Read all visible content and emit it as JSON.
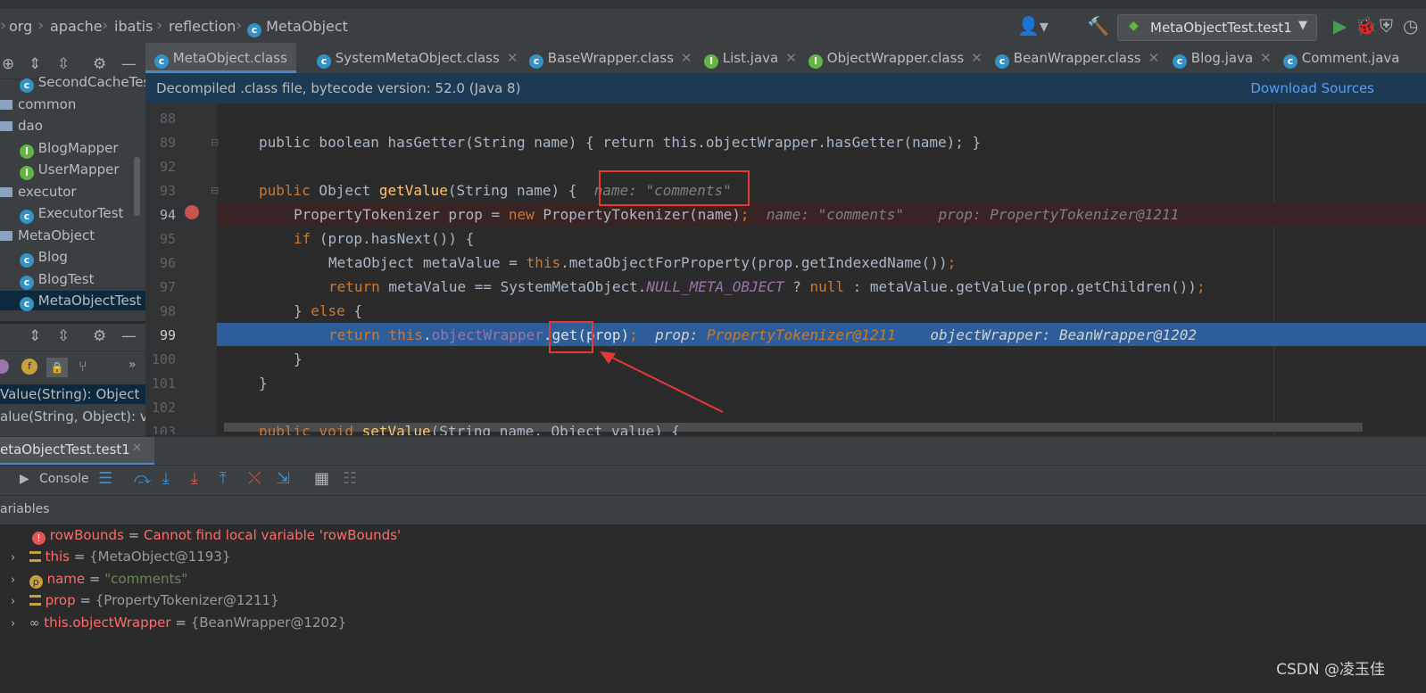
{
  "breadcrumb": [
    "org",
    "apache",
    "ibatis",
    "reflection",
    "MetaObject"
  ],
  "run_config": "MetaObjectTest.test1",
  "tabs": [
    {
      "label": "MetaObject.class",
      "active": true
    },
    {
      "label": "SystemMetaObject.class"
    },
    {
      "label": "BaseWrapper.class"
    },
    {
      "label": "List.java"
    },
    {
      "label": "ObjectWrapper.class"
    },
    {
      "label": "BeanWrapper.class"
    },
    {
      "label": "Blog.java"
    },
    {
      "label": "Comment.java"
    }
  ],
  "info_bar": {
    "text": "Decompiled .class file, bytecode version: 52.0 (Java 8)",
    "link": "Download Sources"
  },
  "project_tree": [
    "SecondCacheTes",
    "common",
    "dao",
    "BlogMapper",
    "UserMapper",
    "executor",
    "ExecutorTest",
    "MetaObject",
    "Blog",
    "BlogTest",
    "MetaObjectTest"
  ],
  "structure_items": [
    "Value(String): Object",
    "alue(String, Object): vo"
  ],
  "code": {
    "lines": [
      "88",
      "89",
      "92",
      "93",
      "94",
      "95",
      "96",
      "97",
      "98",
      "99",
      "100",
      "101",
      "102",
      "103"
    ],
    "l89": "public boolean hasGetter(String name) { return this.objectWrapper.hasGetter(name); }",
    "l93_hint": "name: \"comments\"",
    "l94_hint_a": "name: \"comments\"",
    "l94_hint_b": "prop: PropertyTokenizer@1211",
    "l99_hint_a_name": "prop:",
    "l99_hint_a_val": "PropertyTokenizer@1211",
    "l99_hint_b": "objectWrapper: BeanWrapper@1202"
  },
  "debug": {
    "session_tab": "etaObjectTest.test1",
    "console_label": "Console",
    "variables_label": "ariables",
    "variables": [
      {
        "name": "rowBounds",
        "value": "Cannot find local variable 'rowBounds'",
        "kind": "error"
      },
      {
        "name": "this",
        "value": "{MetaObject@1193}",
        "kind": "object"
      },
      {
        "name": "name",
        "value": "\"comments\"",
        "kind": "string"
      },
      {
        "name": "prop",
        "value": "{PropertyTokenizer@1211}",
        "kind": "object"
      },
      {
        "name": "this.objectWrapper",
        "value": "{BeanWrapper@1202}",
        "kind": "watch"
      }
    ]
  },
  "watermark": "CSDN @凌玉佳"
}
